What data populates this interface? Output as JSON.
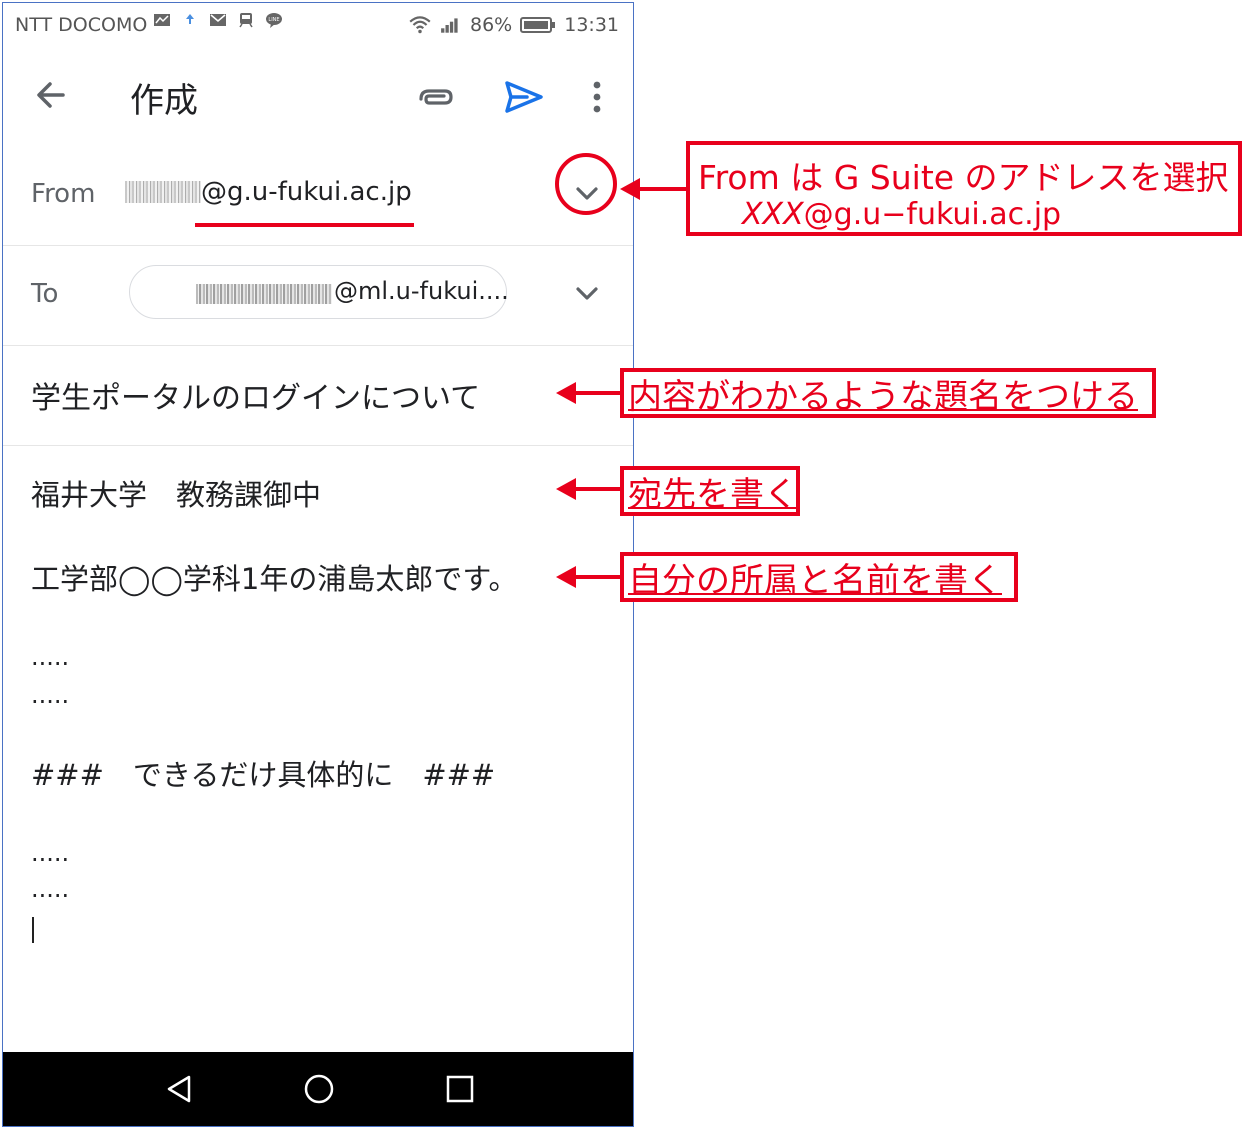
{
  "status_bar": {
    "carrier": "NTT DOCOMO",
    "battery": "86%",
    "time": "13:31"
  },
  "app_bar": {
    "title": "作成",
    "icons": [
      "back-arrow-icon",
      "paperclip-icon",
      "send-icon",
      "more-vert-icon"
    ]
  },
  "compose": {
    "from_label": "From",
    "from_value": "@g.u-fukui.ac.jp",
    "to_label": "To",
    "to_chip": "@ml.u-fukui....",
    "subject": "学生ポータルのログインについて",
    "body_lines": [
      "福井大学　教務課御中",
      "工学部◯◯学科1年の浦島太郎です。",
      ".....",
      ".....",
      "###　できるだけ具体的に　###",
      ".....",
      "....."
    ]
  },
  "annotations": {
    "from_note_line1": "From は G Suite のアドレスを選択",
    "from_note_line2_italic": "XXX",
    "from_note_line2_rest": "@g.u−fukui.ac.jp",
    "subject_note": "内容がわかるような題名をつける",
    "addressee_note": "宛先を書く",
    "self_note": "自分の所属と名前を書く",
    "accent_color": "#e8001c"
  },
  "colors": {
    "send_blue": "#1a73e8",
    "frame_border": "#4a72c4",
    "nav_bar": "#000000"
  }
}
